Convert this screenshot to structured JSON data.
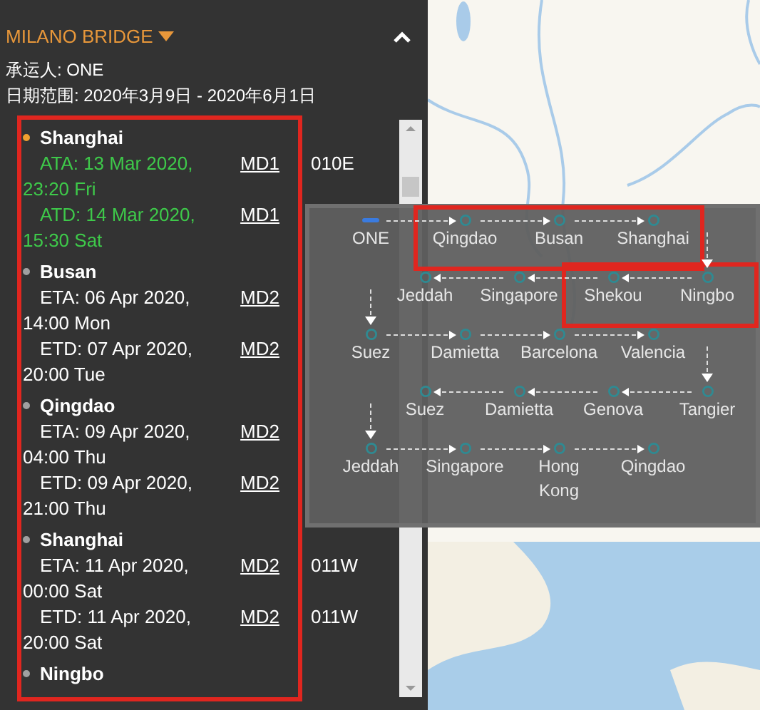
{
  "vessel": {
    "name": "MILANO BRIDGE"
  },
  "carrier_line": "承运人: ONE",
  "date_range": "日期范围: 2020年3月9日 - 2020年6月1日",
  "ports": [
    {
      "name": "Shanghai",
      "current": true,
      "events": [
        {
          "text": "ATA: 13 Mar 2020, 23:20 Fri",
          "actual": true,
          "link": "MD1",
          "voyage": "010E"
        },
        {
          "text": "ATD: 14 Mar 2020, 15:30 Sat",
          "actual": true,
          "link": "MD1"
        }
      ]
    },
    {
      "name": "Busan",
      "current": false,
      "events": [
        {
          "text": "ETA: 06 Apr 2020, 14:00 Mon",
          "actual": false,
          "link": "MD2"
        },
        {
          "text": "ETD: 07 Apr 2020, 20:00 Tue",
          "actual": false,
          "link": "MD2"
        }
      ]
    },
    {
      "name": "Qingdao",
      "current": false,
      "events": [
        {
          "text": "ETA: 09 Apr 2020, 04:00 Thu",
          "actual": false,
          "link": "MD2"
        },
        {
          "text": "ETD: 09 Apr 2020, 21:00 Thu",
          "actual": false,
          "link": "MD2"
        }
      ]
    },
    {
      "name": "Shanghai",
      "current": false,
      "events": [
        {
          "text": "ETA: 11 Apr 2020, 00:00 Sat",
          "actual": false,
          "link": "MD2",
          "voyage": "011W"
        },
        {
          "text": "ETD: 11 Apr 2020, 20:00 Sat",
          "actual": false,
          "link": "MD2",
          "voyage": "011W"
        }
      ]
    },
    {
      "name": "Ningbo",
      "current": false
    }
  ],
  "route": {
    "rows": [
      {
        "stops": [
          {
            "name": "ONE",
            "kind": "carrier",
            "highlighted": false
          },
          {
            "name": "Qingdao",
            "kind": "port",
            "highlighted": true
          },
          {
            "name": "Busan",
            "kind": "port",
            "highlighted": true
          },
          {
            "name": "Shanghai",
            "kind": "port",
            "highlighted": true
          }
        ]
      },
      {
        "stops": [
          {
            "name": "Jeddah",
            "kind": "port",
            "highlighted": false
          },
          {
            "name": "Singapore",
            "kind": "port",
            "highlighted": false
          },
          {
            "name": "Shekou",
            "kind": "port",
            "highlighted": true
          },
          {
            "name": "Ningbo",
            "kind": "port",
            "highlighted": true
          }
        ]
      },
      {
        "stops": [
          {
            "name": "Suez",
            "kind": "port",
            "highlighted": false
          },
          {
            "name": "Damietta",
            "kind": "port",
            "highlighted": false
          },
          {
            "name": "Barcelona",
            "kind": "port",
            "highlighted": false
          },
          {
            "name": "Valencia",
            "kind": "port",
            "highlighted": false
          }
        ]
      },
      {
        "stops": [
          {
            "name": "Suez",
            "kind": "port",
            "highlighted": false
          },
          {
            "name": "Damietta",
            "kind": "port",
            "highlighted": false
          },
          {
            "name": "Genova",
            "kind": "port",
            "highlighted": false
          },
          {
            "name": "Tangier",
            "kind": "port",
            "highlighted": false
          }
        ]
      },
      {
        "stops": [
          {
            "name": "Jeddah",
            "kind": "port",
            "highlighted": false
          },
          {
            "name": "Singapore",
            "kind": "port",
            "highlighted": false
          },
          {
            "name": "Hong Kong",
            "kind": "port",
            "highlighted": false
          },
          {
            "name": "Qingdao",
            "kind": "port",
            "highlighted": false
          }
        ]
      }
    ]
  }
}
